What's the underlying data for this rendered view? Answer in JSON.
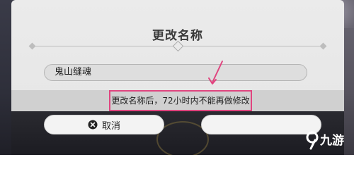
{
  "dialog": {
    "title": "更改名称",
    "name_input": {
      "value": "鬼山缝魂",
      "placeholder": ""
    },
    "notice": "更改名称后，72小时内不能再做修改",
    "cancel_label": "取消",
    "cancel_icon": "close-circle-icon",
    "highlight_color": "#e0457f"
  },
  "watermark": {
    "text": "九游",
    "logo": "9"
  }
}
